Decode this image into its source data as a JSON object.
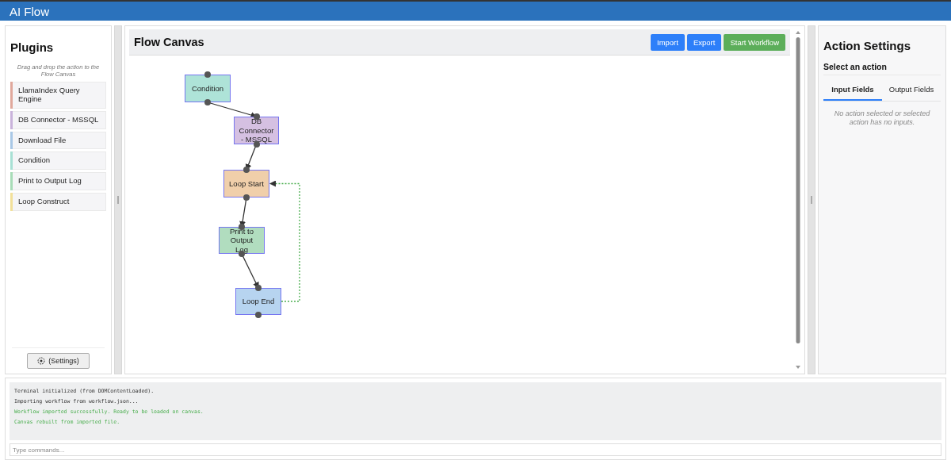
{
  "app": {
    "title": "AI Flow"
  },
  "plugins": {
    "title": "Plugins",
    "hint": "Drag and drop the action to the Flow Canvas",
    "items": [
      {
        "label": "LlamaIndex Query Engine",
        "color": "#e0a89c"
      },
      {
        "label": "DB Connector - MSSQL",
        "color": "#c9b3db"
      },
      {
        "label": "Download File",
        "color": "#a9c8e6"
      },
      {
        "label": "Condition",
        "color": "#a8e0d4"
      },
      {
        "label": "Print to Output Log",
        "color": "#a8dcb8"
      },
      {
        "label": "Loop Construct",
        "color": "#f2e09a"
      }
    ],
    "settings_button": "(Settings)"
  },
  "canvas": {
    "title": "Flow Canvas",
    "buttons": [
      {
        "label": "Import",
        "kind": "primary"
      },
      {
        "label": "Export",
        "kind": "primary"
      },
      {
        "label": "Start Workflow",
        "kind": "success"
      }
    ],
    "nodes": [
      {
        "label": "Condition",
        "color": "#aee3d8"
      },
      {
        "label": "DB Connector - MSSQL",
        "color": "#d5c0e2"
      },
      {
        "label": "Loop Start",
        "color": "#f0cfaa"
      },
      {
        "label": "Print to Output Log",
        "color": "#b1ddbf"
      },
      {
        "label": "Loop End",
        "color": "#b7d4f0"
      }
    ],
    "edges": [
      {
        "kind": "flow"
      },
      {
        "kind": "flow"
      },
      {
        "kind": "flow"
      },
      {
        "kind": "flow"
      },
      {
        "kind": "loop"
      }
    ]
  },
  "action_settings": {
    "title": "Action Settings",
    "subtitle": "Select an action",
    "tabs": [
      {
        "label": "Input Fields",
        "selected": true
      },
      {
        "label": "Output Fields",
        "selected": false
      }
    ],
    "message": "No action selected or selected action has no inputs."
  },
  "terminal": {
    "lines": [
      {
        "text": "Terminal initialized (from DOMContentLoaded).",
        "kind": "info"
      },
      {
        "text": "Importing workflow from workflow.json...",
        "kind": "info"
      },
      {
        "text": "Workflow imported successfully. Ready to be loaded on canvas.",
        "kind": "success"
      },
      {
        "text": "Canvas rebuilt from imported file.",
        "kind": "success"
      }
    ],
    "input_placeholder": "Type commands..."
  }
}
